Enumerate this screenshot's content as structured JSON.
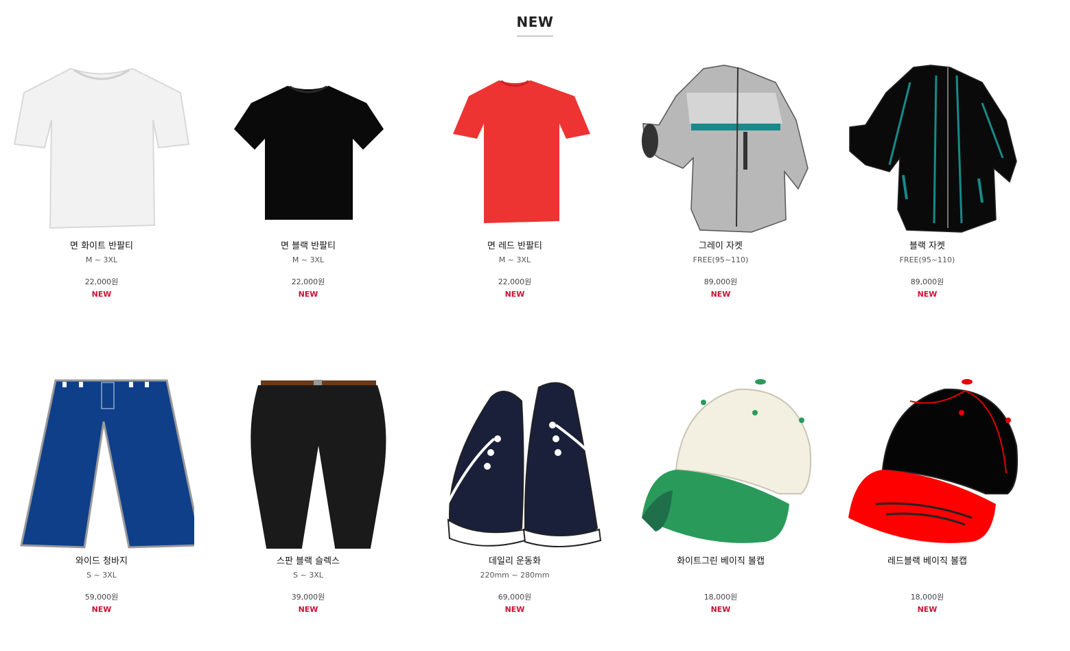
{
  "section": {
    "title": "NEW"
  },
  "products": [
    {
      "name": "면 화이트 반팔티",
      "size": "M ~ 3XL",
      "price": "22,000원",
      "badge": "NEW",
      "image": "white-tshirt"
    },
    {
      "name": "면 블랙 반팔티",
      "size": "M ~ 3XL",
      "price": "22,000원",
      "badge": "NEW",
      "image": "black-tshirt"
    },
    {
      "name": "면 레드 반팔티",
      "size": "M ~ 3XL",
      "price": "22,000원",
      "badge": "NEW",
      "image": "red-tshirt"
    },
    {
      "name": "그레이 자켓",
      "size": "FREE(95~110)",
      "price": "89,000원",
      "badge": "NEW",
      "image": "gray-jacket"
    },
    {
      "name": "블랙 자켓",
      "size": "FREE(95~110)",
      "price": "89,000원",
      "badge": "NEW",
      "image": "black-jacket"
    },
    {
      "name": "와이드 청바지",
      "size": "S ~ 3XL",
      "price": "59,000원",
      "badge": "NEW",
      "image": "wide-jeans"
    },
    {
      "name": "스판 블랙 슬렉스",
      "size": "S ~ 3XL",
      "price": "39,000원",
      "badge": "NEW",
      "image": "black-slacks"
    },
    {
      "name": "데일리 운동화",
      "size": "220mm ~ 280mm",
      "price": "69,000원",
      "badge": "NEW",
      "image": "sneakers"
    },
    {
      "name": "화이트그린 베이직 볼캡",
      "size": "",
      "price": "18,000원",
      "badge": "NEW",
      "image": "white-green-cap"
    },
    {
      "name": "레드블랙 베이직 볼캡",
      "size": "",
      "price": "18,000원",
      "badge": "NEW",
      "image": "red-black-cap"
    }
  ],
  "colors": {
    "badge": "#cc1133",
    "text": "#111111",
    "subtext": "#555555"
  }
}
